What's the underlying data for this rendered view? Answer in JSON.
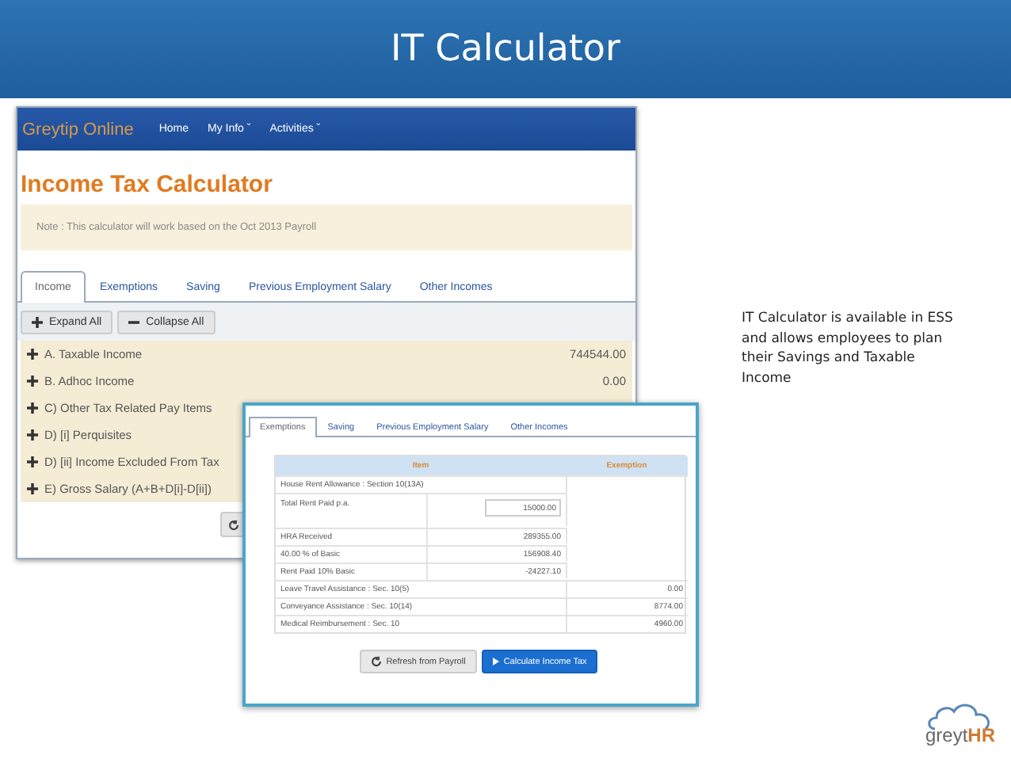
{
  "slide": {
    "title": "IT Calculator",
    "description": "IT Calculator is available in ESS and allows employees to plan their Savings and Taxable Income"
  },
  "main_window": {
    "brand": "Greytip Online",
    "nav": [
      "Home",
      "My Info ˇ",
      "Activities ˇ"
    ],
    "heading": "Income Tax Calculator",
    "note": "Note : This calculator will work based on the Oct 2013 Payroll",
    "tabs": [
      {
        "label": "Income",
        "selected": true
      },
      {
        "label": "Exemptions",
        "selected": false
      },
      {
        "label": "Saving",
        "selected": false
      },
      {
        "label": "Previous Employment Salary",
        "selected": false
      },
      {
        "label": "Other Incomes",
        "selected": false
      }
    ],
    "toolbar": [
      {
        "label": "Expand All",
        "kind": "expand"
      },
      {
        "label": "Collapse All",
        "kind": "collapse"
      }
    ],
    "rows": [
      {
        "label": "A. Taxable Income",
        "value": "744544.00"
      },
      {
        "label": "B. Adhoc Income",
        "value": "0.00"
      },
      {
        "label": "C) Other Tax Related Pay Items"
      },
      {
        "label": "D) [i] Perquisites"
      },
      {
        "label": "D) [ii] Income Excluded From Tax"
      },
      {
        "label": "E) Gross Salary (A+B+D[i]-D[ii])"
      }
    ]
  },
  "exemptions_window": {
    "tabs": [
      {
        "label": "Exemptions",
        "selected": true
      },
      {
        "label": "Saving",
        "selected": false
      },
      {
        "label": "Previous Employment Salary",
        "selected": false
      },
      {
        "label": "Other Incomes",
        "selected": false
      }
    ],
    "columns": [
      "Item",
      "Exemption"
    ],
    "rows": [
      {
        "kind": "section",
        "label": "House Rent Allowance : Section 10(13A)"
      },
      {
        "kind": "input",
        "label": "Total Rent Paid p.a.",
        "value": "15000.00"
      },
      {
        "kind": "sub",
        "label": "HRA Received",
        "value": "289355.00"
      },
      {
        "kind": "sub",
        "label": "40.00 % of Basic",
        "value": "156908.40"
      },
      {
        "kind": "sub",
        "label": "Rent Paid 10% Basic",
        "value": "-24227.10"
      },
      {
        "kind": "item",
        "label": "Leave Travel Assistance : Sec. 10(5)",
        "exemption": "0.00"
      },
      {
        "kind": "item",
        "label": "Conveyance Assistance : Sec. 10(14)",
        "exemption": "8774.00"
      },
      {
        "kind": "item",
        "label": "Medical Reimbursement : Sec. 10",
        "exemption": "4960.00"
      }
    ],
    "buttons": [
      {
        "label": "Refresh from Payroll",
        "kind": "refresh"
      },
      {
        "label": "Calculate Income Tax",
        "kind": "primary"
      }
    ]
  },
  "logo": {
    "text_main": "greyt",
    "text_accent": "HR"
  }
}
